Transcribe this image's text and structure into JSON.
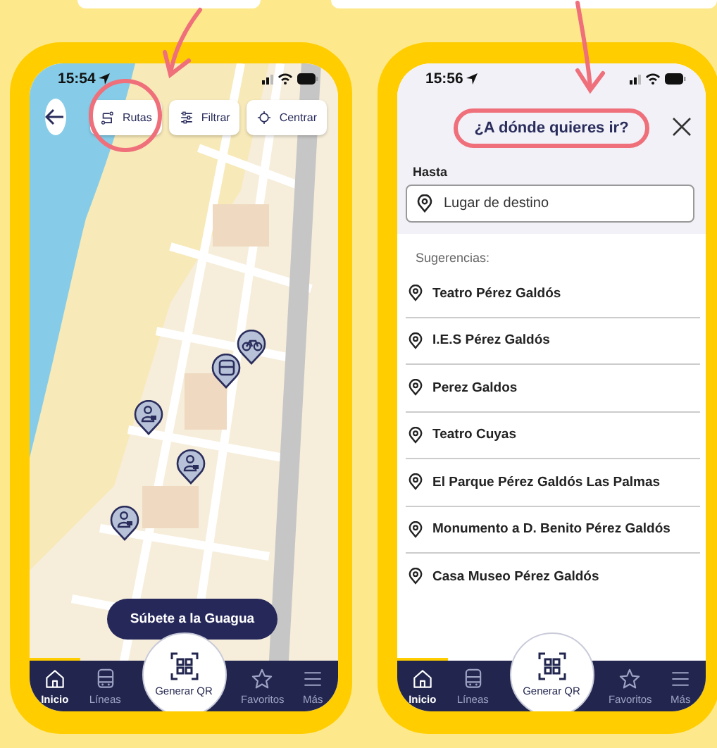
{
  "screens": [
    {
      "kind": "map",
      "status_time": "15:54",
      "toolbar": [
        {
          "label": "Rutas",
          "circled": true
        },
        {
          "label": "Filtrar",
          "circled": false
        },
        {
          "label": "Centrar",
          "circled": false
        }
      ],
      "map_pins": [
        {
          "kind": "bike"
        },
        {
          "kind": "bus"
        },
        {
          "kind": "person"
        },
        {
          "kind": "person"
        },
        {
          "kind": "person"
        }
      ],
      "action_button": "Súbete a la Guagua",
      "nav": {
        "center": "Generar QR",
        "items": [
          {
            "label": "Inicio",
            "selected": true
          },
          {
            "label": "Líneas",
            "selected": false
          },
          {
            "label": "Favoritos",
            "selected": false
          },
          {
            "label": "Más",
            "selected": false
          }
        ]
      }
    },
    {
      "kind": "search",
      "status_time": "15:56",
      "title": "¿A dónde quieres ir?",
      "title_circled": true,
      "field_label": "Hasta",
      "field": {
        "placeholder": "Lugar de destino"
      },
      "suggestions_label": "Sugerencias:",
      "suggestions": [
        "Teatro Pérez Galdós",
        "I.E.S Pérez Galdós",
        "Perez Galdos",
        "Teatro Cuyas",
        "El Parque Pérez Galdós Las Palmas",
        "Monumento a D. Benito Pérez Galdós",
        "Casa Museo Pérez Galdós"
      ],
      "nav": {
        "center": "Generar QR",
        "items": [
          {
            "label": "Inicio",
            "selected": true
          },
          {
            "label": "Líneas",
            "selected": false
          },
          {
            "label": "Favoritos",
            "selected": false
          },
          {
            "label": "Más",
            "selected": false
          }
        ]
      }
    }
  ]
}
